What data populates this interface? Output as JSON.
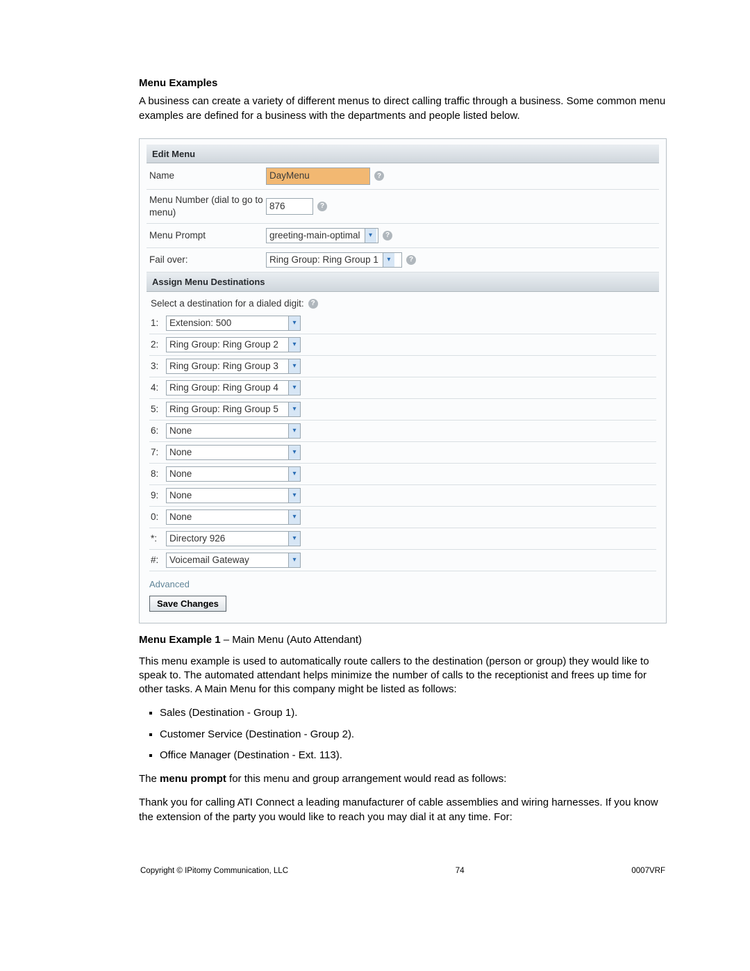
{
  "heading": "Menu Examples",
  "intro": "A business can create a variety of different menus to direct calling traffic through a business. Some common menu examples are defined for a business with the departments and people listed below.",
  "panel": {
    "title": "Edit Menu",
    "fields": {
      "name_label": "Name",
      "name_value": "DayMenu",
      "number_label": "Menu Number (dial to go to menu)",
      "number_value": "876",
      "prompt_label": "Menu Prompt",
      "prompt_value": "greeting-main-optimal",
      "failover_label": "Fail over:",
      "failover_value": "Ring Group: Ring Group 1"
    },
    "destinations_title": "Assign Menu Destinations",
    "destinations_caption": "Select a destination for a dialed digit:",
    "destinations": [
      {
        "digit": "1:",
        "value": "Extension: 500"
      },
      {
        "digit": "2:",
        "value": "Ring Group: Ring Group 2"
      },
      {
        "digit": "3:",
        "value": "Ring Group: Ring Group 3"
      },
      {
        "digit": "4:",
        "value": "Ring Group: Ring Group 4"
      },
      {
        "digit": "5:",
        "value": "Ring Group: Ring Group 5"
      },
      {
        "digit": "6:",
        "value": "None"
      },
      {
        "digit": "7:",
        "value": "None"
      },
      {
        "digit": "8:",
        "value": "None"
      },
      {
        "digit": "9:",
        "value": "None"
      },
      {
        "digit": "0:",
        "value": "None"
      },
      {
        "digit": "*:",
        "value": "Directory 926"
      },
      {
        "digit": "#:",
        "value": "Voicemail Gateway"
      }
    ],
    "advanced": "Advanced",
    "save": "Save Changes"
  },
  "example1_heading_bold": "Menu Example 1",
  "example1_heading_rest": " – Main Menu (Auto Attendant)",
  "example1_para": "This menu example is used to automatically route callers to the destination (person or group) they would like to speak to. The automated attendant helps minimize the number of calls to the receptionist and frees up time for other tasks. A Main Menu for this company might be listed as follows:",
  "dest_list": [
    "Sales (Destination - Group 1).",
    "Customer Service (Destination - Group 2).",
    "Office Manager (Destination - Ext. 113)."
  ],
  "prompt_sentence_pre": "The ",
  "prompt_sentence_bold": "menu prompt",
  "prompt_sentence_post": " for this menu and group arrangement would read as follows:",
  "closing_para": "Thank you for calling ATI Connect a leading manufacturer of cable assemblies and wiring harnesses. If you know the extension of the party you would like to reach you may dial it at any time. For:",
  "footer": {
    "left": "Copyright © IPitomy Communication, LLC",
    "center": "74",
    "right": "0007VRF"
  }
}
